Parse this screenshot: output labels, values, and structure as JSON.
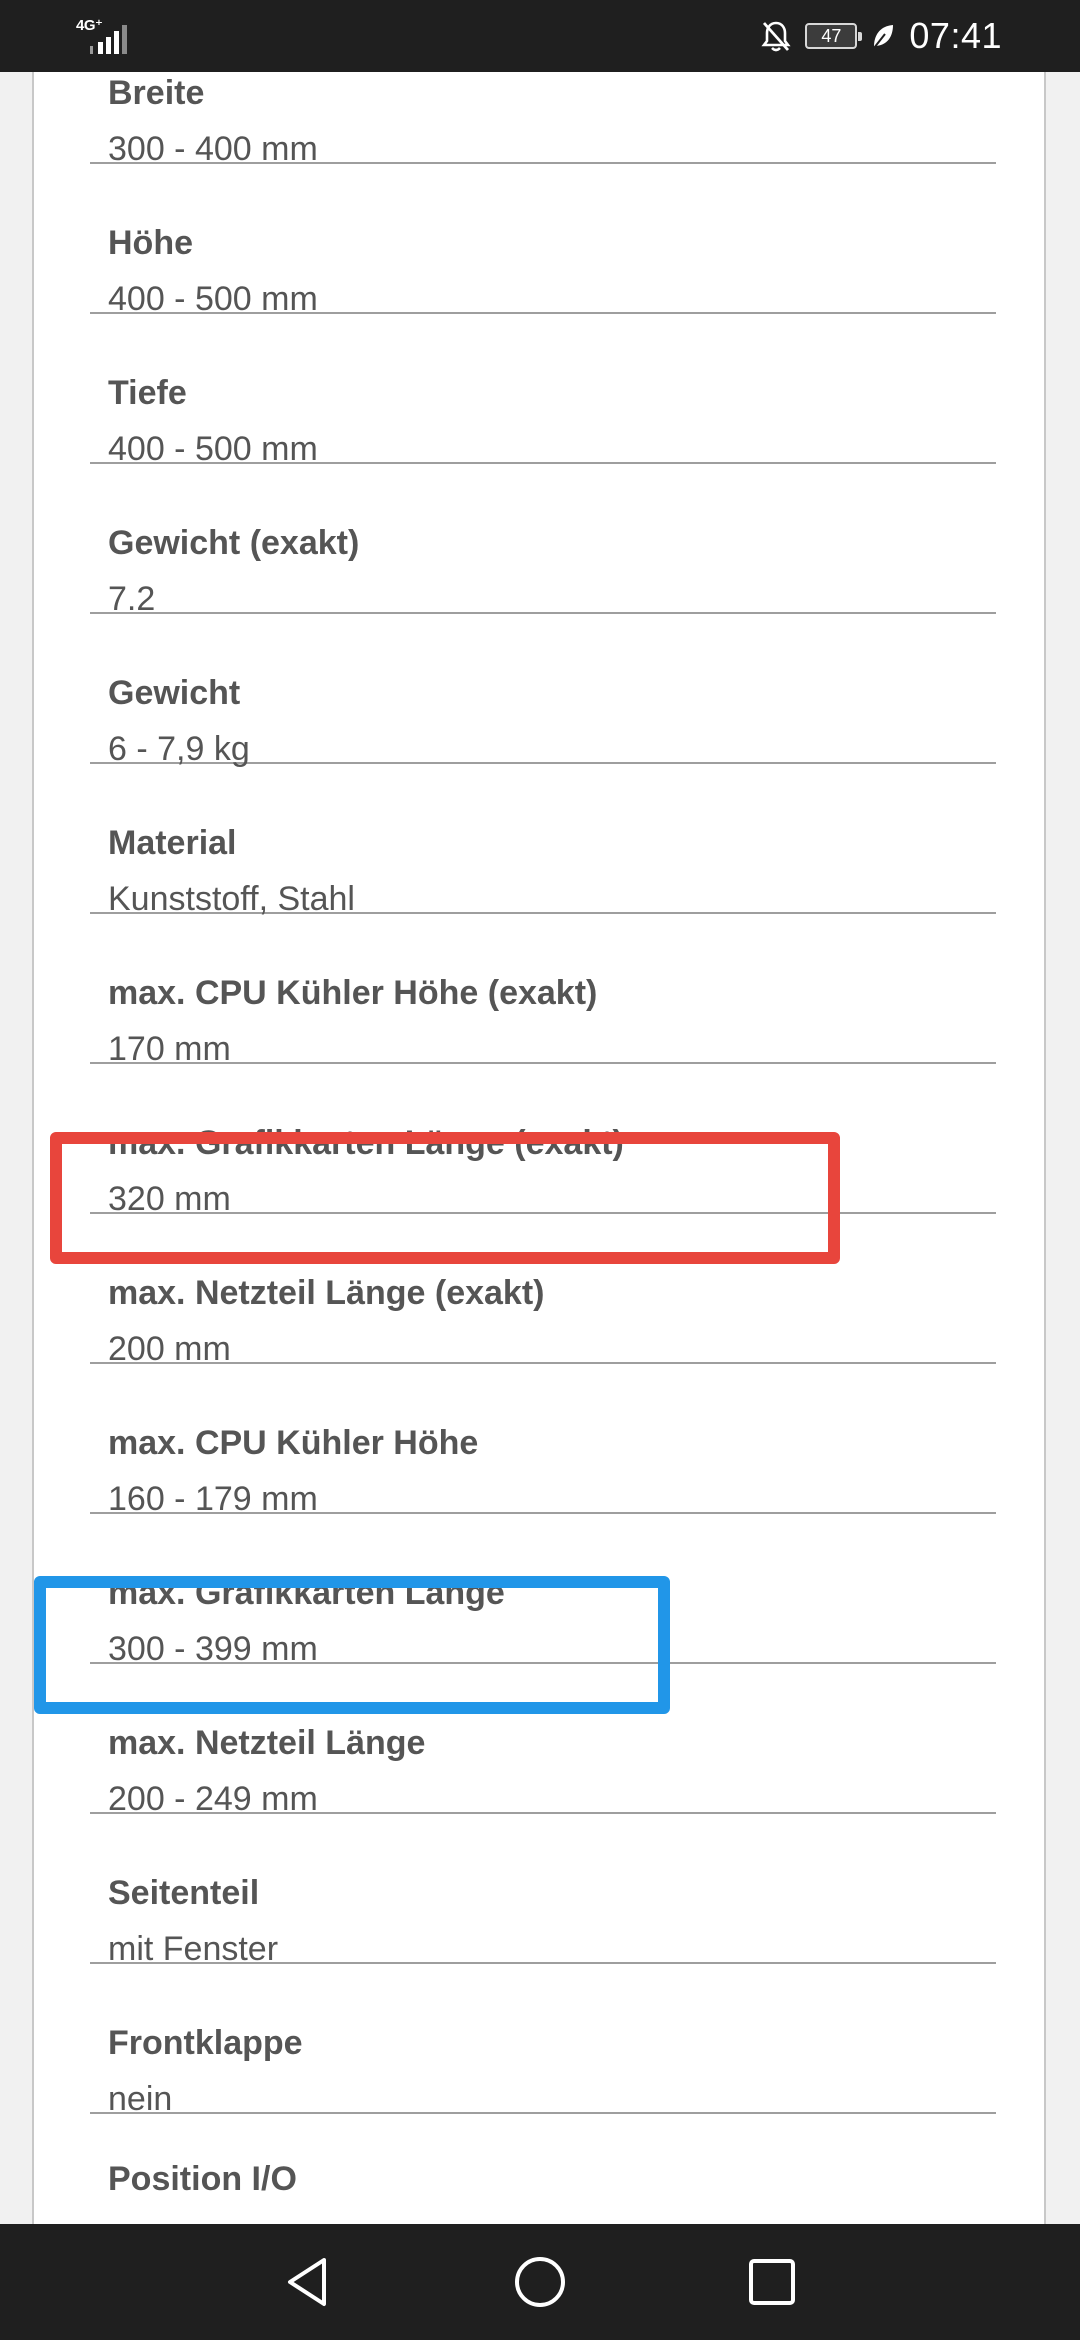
{
  "status_bar": {
    "network": "4G⁺",
    "battery": "47",
    "time": "07:41",
    "icons": [
      "signal-bars-icon",
      "bell-muted-icon",
      "battery-icon",
      "leaf-icon"
    ]
  },
  "specs": [
    {
      "label": "Breite",
      "value": "300 - 400 mm"
    },
    {
      "label": "Höhe",
      "value": "400 - 500 mm"
    },
    {
      "label": "Tiefe",
      "value": "400 - 500 mm"
    },
    {
      "label": "Gewicht (exakt)",
      "value": "7.2"
    },
    {
      "label": "Gewicht",
      "value": "6 - 7,9 kg"
    },
    {
      "label": "Material",
      "value": "Kunststoff, Stahl"
    },
    {
      "label": "max. CPU Kühler Höhe (exakt)",
      "value": "170 mm"
    },
    {
      "label": "max. Grafikkarten Länge (exakt)",
      "value": "320 mm"
    },
    {
      "label": "max. Netzteil Länge (exakt)",
      "value": "200 mm"
    },
    {
      "label": "max. CPU Kühler Höhe",
      "value": "160 - 179 mm"
    },
    {
      "label": "max. Grafikkarten Länge",
      "value": "300 - 399 mm"
    },
    {
      "label": "max. Netzteil Länge",
      "value": "200 - 249 mm"
    },
    {
      "label": "Seitenteil",
      "value": "mit Fenster"
    },
    {
      "label": "Frontklappe",
      "value": "nein"
    },
    {
      "label": "Position I/O",
      "value": ""
    }
  ],
  "highlights": [
    {
      "color": "#e8453c",
      "target": "max. Grafikkarten Länge (exakt)"
    },
    {
      "color": "#2196e8",
      "target": "max. Grafikkarten Länge"
    }
  ],
  "nav_bar": {
    "icons": [
      "back-icon",
      "home-icon",
      "recents-icon"
    ]
  }
}
